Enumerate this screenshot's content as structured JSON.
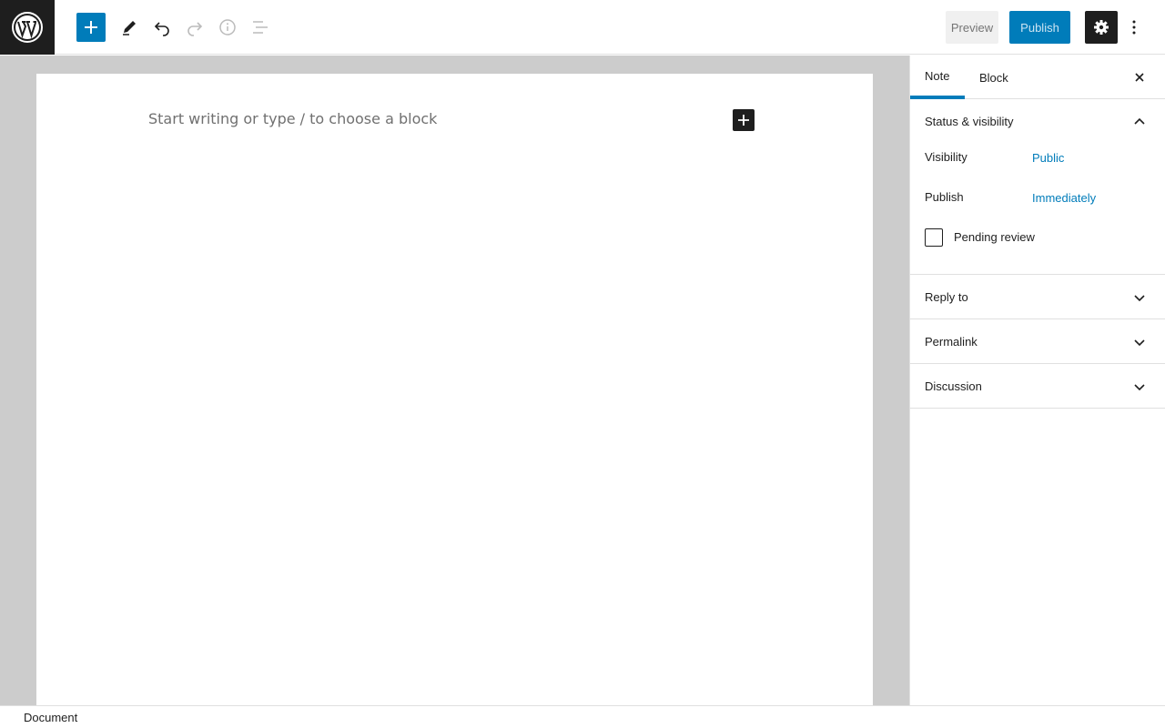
{
  "toolbar": {
    "inserter_icon": "plus-icon",
    "tools": [
      "pencil-icon",
      "undo-icon",
      "redo-icon",
      "info-icon",
      "list-view-icon"
    ],
    "preview_label": "Preview",
    "publish_label": "Publish",
    "settings_icon": "gear-icon",
    "more_icon": "vertical-ellipsis-icon"
  },
  "editor": {
    "placeholder": "Start writing or type / to choose a block"
  },
  "sidebar": {
    "tabs": [
      {
        "label": "Note",
        "active": true
      },
      {
        "label": "Block",
        "active": false
      }
    ],
    "status_panel": {
      "title": "Status & visibility",
      "expanded": true,
      "visibility_label": "Visibility",
      "visibility_value": "Public",
      "publish_label": "Publish",
      "publish_value": "Immediately",
      "pending_review_label": "Pending review",
      "pending_review_checked": false
    },
    "panels": [
      {
        "title": "Reply to",
        "expanded": false
      },
      {
        "title": "Permalink",
        "expanded": false
      },
      {
        "title": "Discussion",
        "expanded": false
      }
    ]
  },
  "footer": {
    "breadcrumb": "Document"
  },
  "colors": {
    "accent": "#007cba",
    "dark": "#1e1e1e",
    "canvas_bg": "#cccccc"
  }
}
